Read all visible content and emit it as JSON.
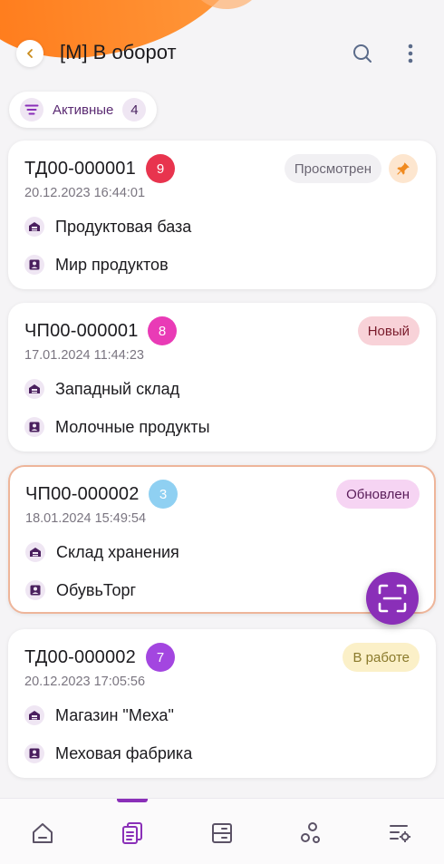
{
  "header": {
    "title": "[М] В оборот"
  },
  "filter": {
    "label": "Активные",
    "count": "4"
  },
  "colors": {
    "accent": "#8a2fb8",
    "orange": "#ff7a1a"
  },
  "cards": [
    {
      "number": "ТД00-000001",
      "count": "9",
      "count_color": "#e8344e",
      "date": "20.12.2023 16:44:01",
      "status": "Просмотрен",
      "status_bg": "#f1f0f3",
      "status_fg": "#6b6673",
      "pinned": true,
      "warehouse": "Продуктовая база",
      "counterparty": "Мир продуктов"
    },
    {
      "number": "ЧП00-000001",
      "count": "8",
      "count_color": "#e93bb6",
      "date": "17.01.2024 11:44:23",
      "status": "Новый",
      "status_bg": "#f8d2d8",
      "status_fg": "#7a1c2c",
      "pinned": false,
      "warehouse": "Западный склад",
      "counterparty": "Молочные продукты"
    },
    {
      "number": "ЧП00-000002",
      "count": "3",
      "count_color": "#8fd0f2",
      "date": "18.01.2024 15:49:54",
      "status": "Обновлен",
      "status_bg": "#f6d4f3",
      "status_fg": "#5a1d5a",
      "pinned": false,
      "warehouse": "Склад хранения",
      "counterparty": "ОбувьТорг"
    },
    {
      "number": "ТД00-000002",
      "count": "7",
      "count_color": "#a346e0",
      "date": "20.12.2023 17:05:56",
      "status": "В работе",
      "status_bg": "#fbf0c8",
      "status_fg": "#8a7a2c",
      "pinned": false,
      "warehouse": "Магазин \"Меха\"",
      "counterparty": "Меховая фабрика"
    }
  ],
  "nav": {
    "items": [
      "home-icon",
      "documents-icon",
      "list-icon",
      "circles-icon",
      "settings-icon"
    ],
    "active": 1
  }
}
